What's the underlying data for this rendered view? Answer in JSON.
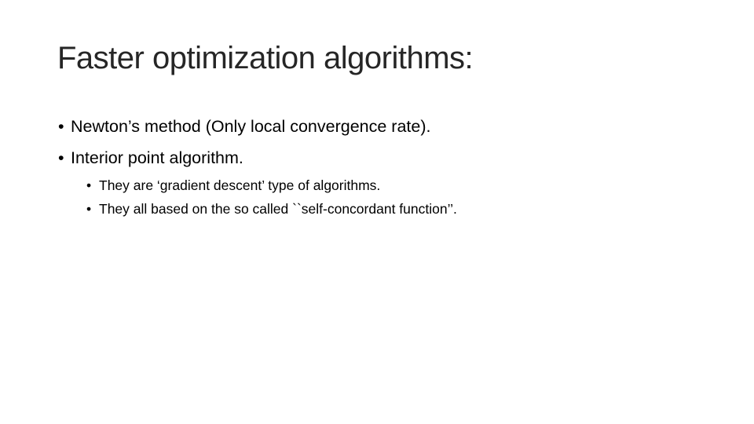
{
  "slide": {
    "title": "Faster optimization algorithms:",
    "bullets": [
      {
        "text": "Newton’s method (Only local convergence rate).",
        "level": 1
      },
      {
        "text": "Interior point algorithm.",
        "level": 1
      },
      {
        "text": "They are ‘gradient descent’ type of algorithms.",
        "level": 2
      },
      {
        "text": "They all based on the so called ``self-concordant function’’.",
        "level": 2
      }
    ],
    "bullet_glyph": "•"
  }
}
